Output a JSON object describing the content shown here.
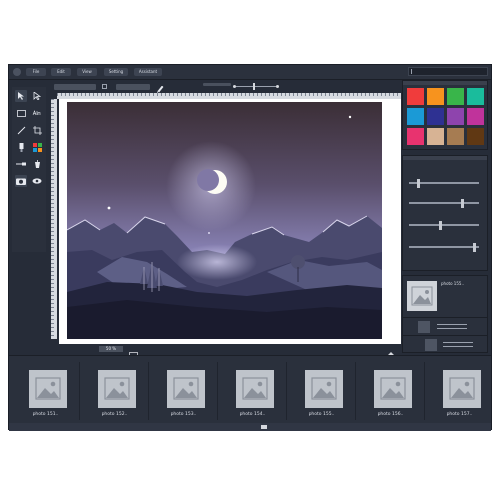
{
  "menu": {
    "items": [
      "File",
      "Edit",
      "View",
      "Setting",
      "Assistant"
    ]
  },
  "status": {
    "zoom": "50 %"
  },
  "palette": {
    "swatches": [
      "#f03c3c",
      "#f7931e",
      "#39b54a",
      "#1abc9c",
      "#1b9ad6",
      "#2e3192",
      "#8e44ad",
      "#c0339b",
      "#e8336f",
      "#d7b394",
      "#a67c52",
      "#603813"
    ]
  },
  "sliders": {
    "levels": [
      0.12,
      0.78,
      0.45,
      0.95
    ]
  },
  "layers": {
    "items": [
      {
        "name": "photo 155.."
      }
    ]
  },
  "filmstrip": {
    "items": [
      {
        "label": "photo 151.."
      },
      {
        "label": "photo 152.."
      },
      {
        "label": "photo 153.."
      },
      {
        "label": "photo 154.."
      },
      {
        "label": "photo 155.."
      },
      {
        "label": "photo 156.."
      },
      {
        "label": "photo 157.."
      }
    ]
  },
  "icons": [
    "app-logo-icon",
    "search-icon",
    "select-arrow-icon",
    "direct-select-icon",
    "rectangle-icon",
    "text-icon",
    "line-icon",
    "crop-icon",
    "brush-icon",
    "gradient-icon",
    "eyedropper-icon",
    "bucket-icon",
    "camera-icon",
    "eye-icon",
    "list-icon",
    "monitor-icon",
    "prev-icon",
    "dot-icon",
    "next-icon",
    "export-icon",
    "image-placeholder-icon"
  ]
}
